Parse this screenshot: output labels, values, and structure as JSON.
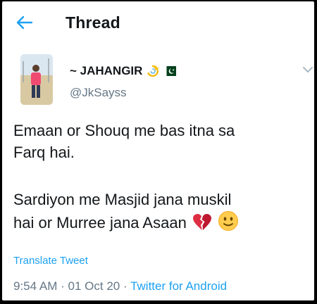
{
  "header": {
    "title": "Thread",
    "back_icon": "arrow-left-icon"
  },
  "author": {
    "display_name": "~ JAHANGIR",
    "handle": "@JkSayss",
    "name_emojis": [
      "dizzy-emoji",
      "pakistan-flag-emoji"
    ]
  },
  "tweet": {
    "lines": [
      "Emaan or Shouq me bas itna sa",
      "Farq hai.",
      "Sardiyon me Masjid jana muskil",
      "hai or Murree jana Asaan"
    ],
    "trailing_emojis": [
      "broken-heart-emoji",
      "slightly-smiling-face-emoji"
    ],
    "translate_label": "Translate Tweet"
  },
  "meta": {
    "time": "9:54 AM",
    "separator": "·",
    "date": "01 Oct 20",
    "source": "Twitter for Android"
  },
  "colors": {
    "accent": "#1da1f2",
    "text": "#14171a",
    "muted": "#657786",
    "background": "#ffffff"
  }
}
